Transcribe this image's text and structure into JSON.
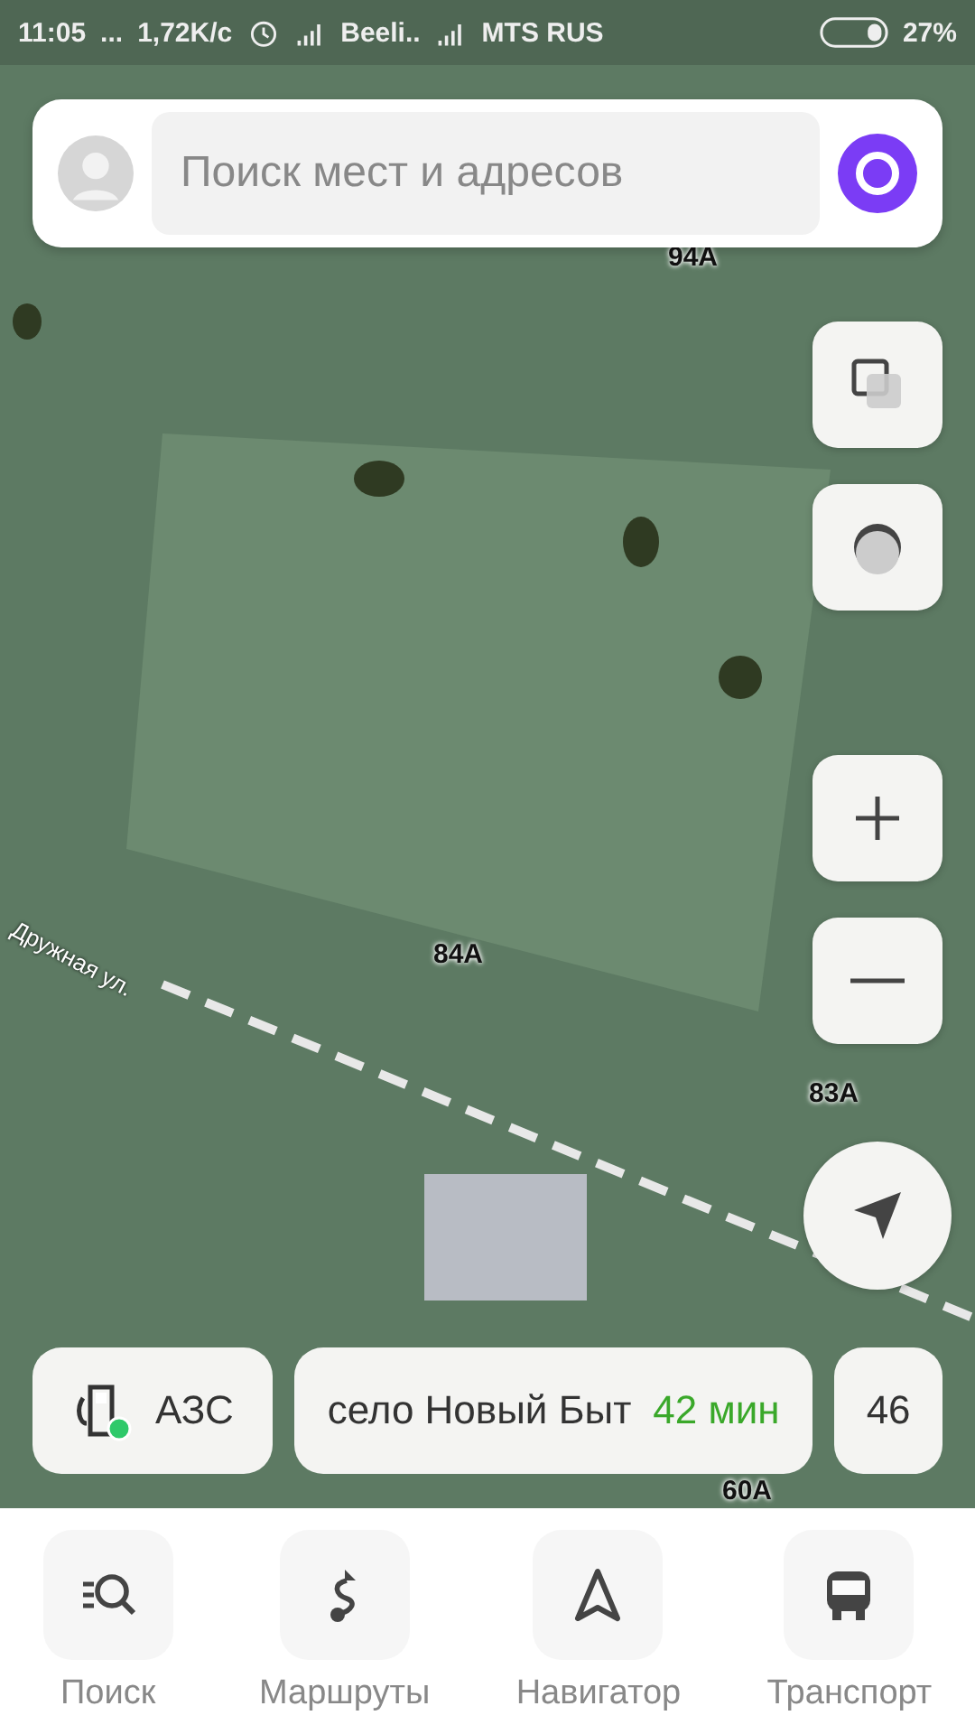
{
  "status_bar": {
    "time": "11:05",
    "notification_dots": "...",
    "speed": "1,72K/c",
    "carrier_1": "Beeli..",
    "carrier_2": "MTS RUS",
    "battery": "27%"
  },
  "search": {
    "placeholder": "Поиск мест и адресов"
  },
  "map_labels": [
    {
      "kind": "address",
      "text": "94A"
    },
    {
      "kind": "street",
      "text": "Дружная ул."
    },
    {
      "kind": "address",
      "text": "84A"
    },
    {
      "kind": "address",
      "text": "83A"
    },
    {
      "kind": "address",
      "text": "60A"
    }
  ],
  "chips": [
    {
      "kind": "category",
      "label": "АЗС"
    },
    {
      "kind": "route",
      "label": "село Новый Быт",
      "duration": "42 мин"
    },
    {
      "kind": "category",
      "label": "46"
    }
  ],
  "nav": [
    {
      "kind": "search",
      "label": "Поиск"
    },
    {
      "kind": "routes",
      "label": "Маршруты"
    },
    {
      "kind": "navigator",
      "label": "Навигатор"
    },
    {
      "kind": "transport",
      "label": "Транспорт"
    }
  ]
}
